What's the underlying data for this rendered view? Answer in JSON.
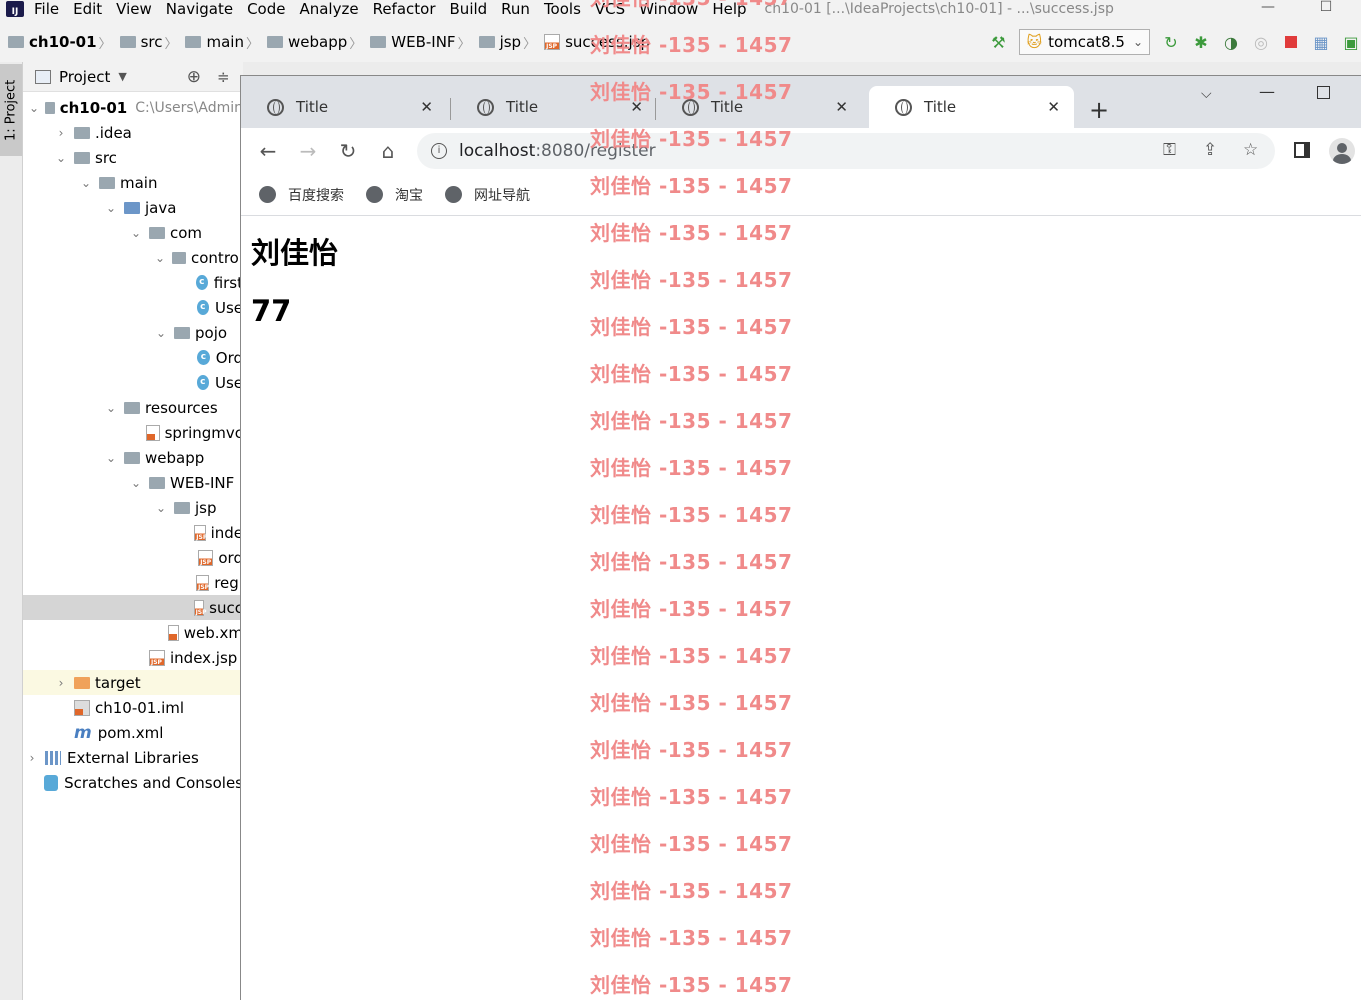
{
  "ide": {
    "menu": [
      "File",
      "Edit",
      "View",
      "Navigate",
      "Code",
      "Analyze",
      "Refactor",
      "Build",
      "Run",
      "Tools",
      "VCS",
      "Window",
      "Help"
    ],
    "window_title": "ch10-01 [...\\IdeaProjects\\ch10-01] - ...\\success.jsp",
    "breadcrumb": [
      "ch10-01",
      "src",
      "main",
      "webapp",
      "WEB-INF",
      "jsp",
      "success.jsp"
    ],
    "run_config": "tomcat8.5",
    "left_tab": "1: Project",
    "project_panel": {
      "title": "Project",
      "root_name": "ch10-01",
      "root_path": "C:\\Users\\Admin"
    },
    "tree": [
      {
        "label": ".idea",
        "indent": 1,
        "arrow": "›",
        "icon": "folder"
      },
      {
        "label": "src",
        "indent": 1,
        "arrow": "⌄",
        "icon": "folder"
      },
      {
        "label": "main",
        "indent": 2,
        "arrow": "⌄",
        "icon": "folder"
      },
      {
        "label": "java",
        "indent": 3,
        "arrow": "⌄",
        "icon": "folder-blue"
      },
      {
        "label": "com",
        "indent": 4,
        "arrow": "⌄",
        "icon": "folder"
      },
      {
        "label": "control",
        "indent": 5,
        "arrow": "⌄",
        "icon": "folder"
      },
      {
        "label": "first",
        "indent": 6,
        "arrow": "",
        "icon": "class"
      },
      {
        "label": "Use",
        "indent": 6,
        "arrow": "",
        "icon": "class"
      },
      {
        "label": "pojo",
        "indent": 5,
        "arrow": "⌄",
        "icon": "folder"
      },
      {
        "label": "Ord",
        "indent": 6,
        "arrow": "",
        "icon": "class"
      },
      {
        "label": "Use",
        "indent": 6,
        "arrow": "",
        "icon": "class"
      },
      {
        "label": "resources",
        "indent": 3,
        "arrow": "⌄",
        "icon": "folder"
      },
      {
        "label": "springmvc",
        "indent": 4,
        "arrow": "",
        "icon": "xml"
      },
      {
        "label": "webapp",
        "indent": 3,
        "arrow": "⌄",
        "icon": "folder"
      },
      {
        "label": "WEB-INF",
        "indent": 4,
        "arrow": "⌄",
        "icon": "folder"
      },
      {
        "label": "jsp",
        "indent": 5,
        "arrow": "⌄",
        "icon": "folder"
      },
      {
        "label": "inde",
        "indent": 6,
        "arrow": "",
        "icon": "jsp"
      },
      {
        "label": "ord",
        "indent": 6,
        "arrow": "",
        "icon": "jsp"
      },
      {
        "label": "regi",
        "indent": 6,
        "arrow": "",
        "icon": "jsp"
      },
      {
        "label": "succ",
        "indent": 6,
        "arrow": "",
        "icon": "jsp",
        "selected": true
      },
      {
        "label": "web.xm",
        "indent": 5,
        "arrow": "",
        "icon": "xml"
      },
      {
        "label": "index.jsp",
        "indent": 4,
        "arrow": "",
        "icon": "jsp"
      },
      {
        "label": "target",
        "indent": 1,
        "arrow": "›",
        "icon": "folder-orange",
        "highlight": true
      },
      {
        "label": "ch10-01.iml",
        "indent": 1,
        "arrow": "",
        "icon": "iml"
      },
      {
        "label": "pom.xml",
        "indent": 1,
        "arrow": "",
        "icon": "maven"
      },
      {
        "label": "External Libraries",
        "indent": 0,
        "arrow": "›",
        "icon": "lib"
      },
      {
        "label": "Scratches and Consoles",
        "indent": 0,
        "arrow": "",
        "icon": "scratch"
      }
    ]
  },
  "browser": {
    "tabs": [
      {
        "title": "Title",
        "active": false
      },
      {
        "title": "Title",
        "active": false
      },
      {
        "title": "Title",
        "active": false
      },
      {
        "title": "Title",
        "active": true
      }
    ],
    "url_host": "localhost",
    "url_rest": ":8080/register",
    "bookmarks": [
      "百度搜索",
      "淘宝",
      "网址导航"
    ]
  },
  "page": {
    "heading1": "刘佳怡",
    "heading2": "77"
  },
  "watermark": {
    "text": "刘佳怡 -135 - 1457",
    "color": "#f08a8a",
    "count": 22
  }
}
